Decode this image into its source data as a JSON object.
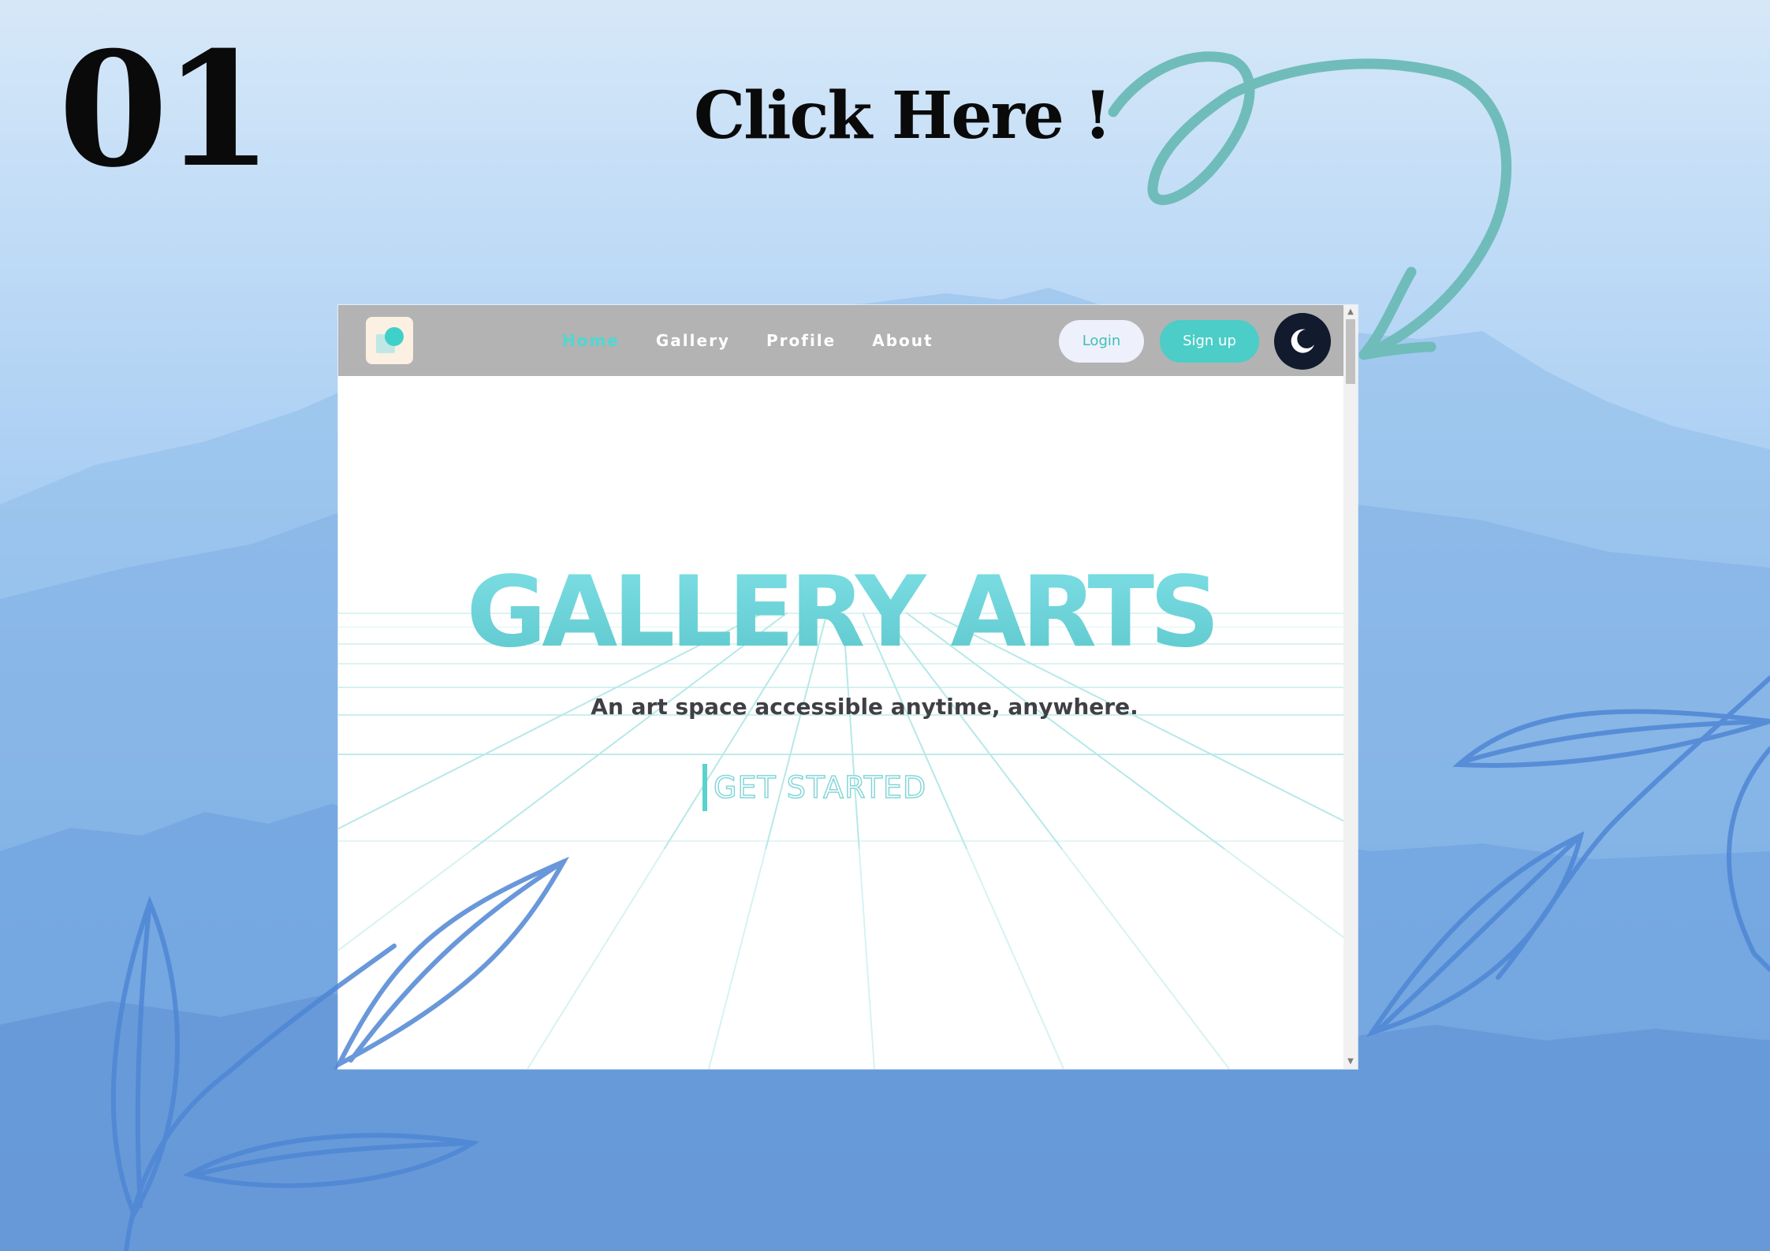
{
  "poster": {
    "step_number": "01",
    "headline": "Click Here !"
  },
  "nav": {
    "items": [
      {
        "label": "Home",
        "active": true
      },
      {
        "label": "Gallery",
        "active": false
      },
      {
        "label": "Profile",
        "active": false
      },
      {
        "label": "About",
        "active": false
      }
    ],
    "login_label": "Login",
    "signup_label": "Sign up",
    "theme_icon": "moon-icon"
  },
  "hero": {
    "title": "GALLERY ARTS",
    "subtitle": "An art space accessible anytime, anywhere.",
    "cta_label": "GET STARTED"
  },
  "colors": {
    "accent": "#4ccdc7",
    "navbar": "#b3b3b3",
    "arrow": "#6fbcbb",
    "leaf_stroke": "#4f86d4",
    "theme_button": "#121a2e"
  }
}
